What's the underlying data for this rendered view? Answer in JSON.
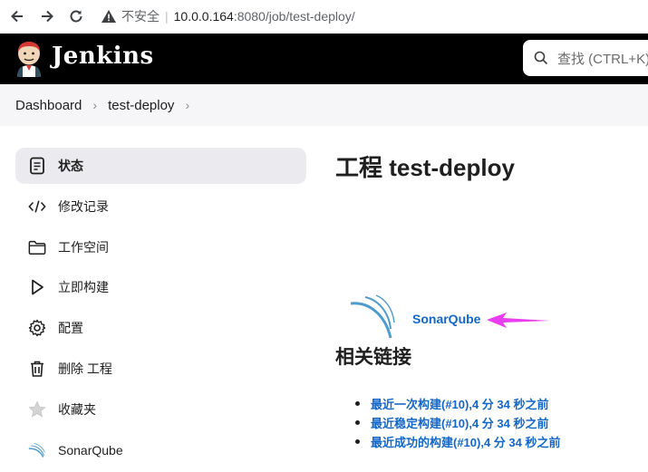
{
  "browser": {
    "insecure_label": "不安全",
    "url_host": "10.0.0.164",
    "url_rest": ":8080/job/test-deploy/"
  },
  "header": {
    "brand": "Jenkins",
    "search_placeholder": "查找 (CTRL+K)"
  },
  "breadcrumb": {
    "items": [
      "Dashboard",
      "test-deploy"
    ]
  },
  "sidebar": {
    "items": [
      {
        "label": "状态",
        "icon": "notepad-icon"
      },
      {
        "label": "修改记录",
        "icon": "code-icon"
      },
      {
        "label": "工作空间",
        "icon": "folder-icon"
      },
      {
        "label": "立即构建",
        "icon": "play-icon"
      },
      {
        "label": "配置",
        "icon": "gear-icon"
      },
      {
        "label": "删除 工程",
        "icon": "trash-icon"
      },
      {
        "label": "收藏夹",
        "icon": "star-icon"
      },
      {
        "label": "SonarQube",
        "icon": "sonarqube-icon"
      }
    ]
  },
  "main": {
    "title": "工程 test-deploy",
    "sonar_link": "SonarQube",
    "related_heading": "相关链接",
    "links": [
      "最近一次构建(#10),4 分 34 秒之前",
      "最近稳定构建(#10),4 分 34 秒之前",
      "最近成功的构建(#10),4 分 34 秒之前"
    ]
  },
  "colors": {
    "link": "#1367c8",
    "annotation_arrow": "#e93df0",
    "header_bg": "#000000"
  }
}
